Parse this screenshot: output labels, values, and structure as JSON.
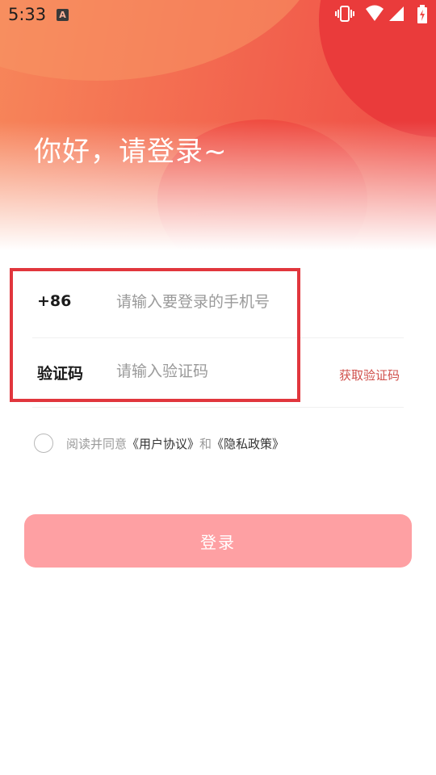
{
  "status_bar": {
    "time": "5:33",
    "notification_icon_glyph": "A",
    "icons": [
      "vibrate-icon",
      "wifi-icon",
      "signal-icon",
      "battery-charging-icon"
    ]
  },
  "header": {
    "greeting": "你好，请登录~"
  },
  "form": {
    "phone": {
      "country_code": "+86",
      "value": "",
      "placeholder": "请输入要登录的手机号"
    },
    "code": {
      "label": "验证码",
      "value": "",
      "placeholder": "请输入验证码",
      "get_code_label": "获取验证码"
    }
  },
  "agreement": {
    "checked": false,
    "prefix": "阅读并同意",
    "user_agreement": "《用户协议》",
    "conjunction": "和",
    "privacy_policy": "《隐私政策》"
  },
  "login_button": {
    "label": "登录"
  },
  "colors": {
    "brand": "#ef4a45",
    "button": "#fea0a3",
    "link_accent": "#d0504b",
    "highlight": "#e1363d"
  }
}
